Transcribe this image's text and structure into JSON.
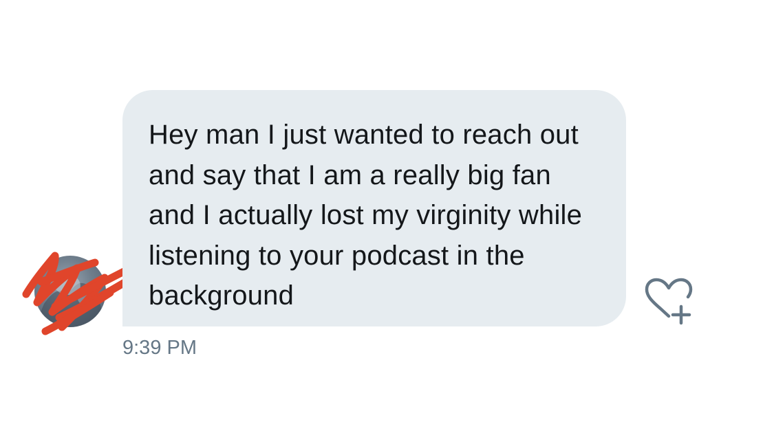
{
  "message": {
    "text": "Hey man I just wanted to reach out and say that I am a really big fan and I actually lost my virginity while listening to your podcast in the background",
    "timestamp": "9:39 PM",
    "avatar_icon": "avatar-icon",
    "reaction_icon": "heart-plus-icon"
  },
  "colors": {
    "bubble": "#e6ecf0",
    "text": "#14171a",
    "timestamp": "#657786",
    "icon": "#657786",
    "redaction": "#e0452b"
  }
}
